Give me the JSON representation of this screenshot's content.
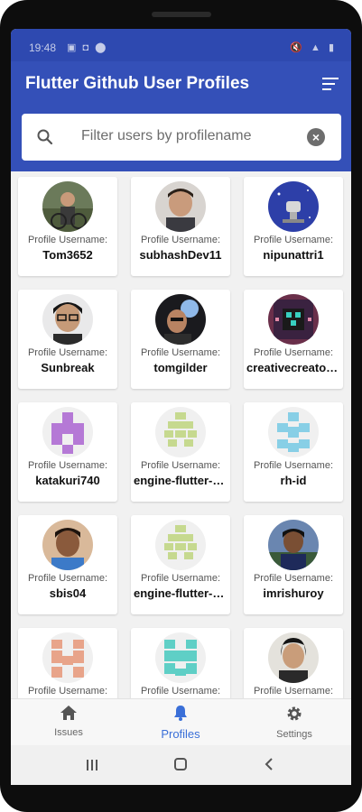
{
  "status_bar": {
    "time": "19:48"
  },
  "app_bar": {
    "title": "Flutter Github User Profiles"
  },
  "search": {
    "placeholder": "Filter users by profilename"
  },
  "profile_label": "Profile Username:",
  "profiles": [
    {
      "username": "Tom3652"
    },
    {
      "username": "subhashDev11"
    },
    {
      "username": "nipunattri1"
    },
    {
      "username": "Sunbreak"
    },
    {
      "username": "tomgilder"
    },
    {
      "username": "creativecreatorormaybenot"
    },
    {
      "username": "katakuri740"
    },
    {
      "username": "engine-flutter-autoroll"
    },
    {
      "username": "rh-id"
    },
    {
      "username": "sbis04"
    },
    {
      "username": "engine-flutter-autoroll"
    },
    {
      "username": "imrishuroy"
    },
    {
      "username": ""
    },
    {
      "username": ""
    },
    {
      "username": ""
    }
  ],
  "bottom_nav": {
    "items": [
      {
        "label": "Issues",
        "icon": "home-icon"
      },
      {
        "label": "Profiles",
        "icon": "bell-icon",
        "active": true
      },
      {
        "label": "Settings",
        "icon": "gear-icon"
      }
    ]
  },
  "colors": {
    "primary": "#3450b8",
    "active_tab": "#3a6fd8"
  }
}
